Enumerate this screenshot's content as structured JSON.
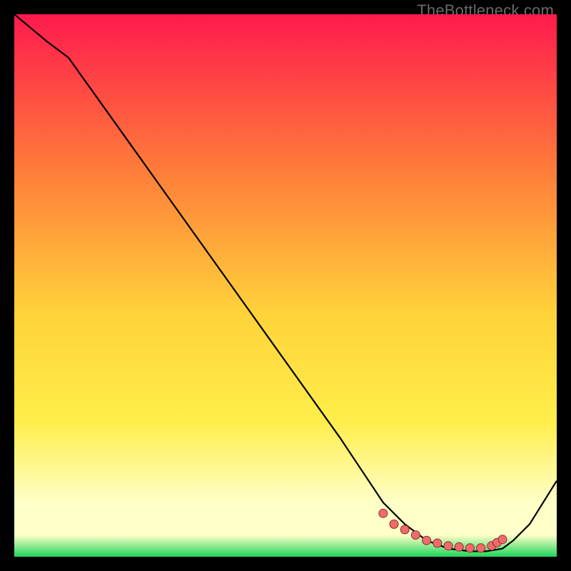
{
  "watermark": "TheBottleneck.com",
  "colors": {
    "bg_black": "#000000",
    "grad_top": "#ff1a4d",
    "grad_mid_upper": "#ff7a3a",
    "grad_mid": "#ffd23a",
    "grad_mid_lower": "#ffee4a",
    "grad_lower_pale": "#ffffc8",
    "grad_green": "#1fd65b",
    "curve_stroke": "#000000",
    "marker_fill": "#f06a6a",
    "marker_stroke": "#8b2e2e"
  },
  "chart_data": {
    "type": "line",
    "title": "",
    "xlabel": "",
    "ylabel": "",
    "xlim": [
      0,
      100
    ],
    "ylim": [
      0,
      100
    ],
    "series": [
      {
        "name": "bottleneck-curve",
        "x": [
          0,
          6,
          10,
          20,
          30,
          40,
          50,
          60,
          68,
          72,
          76,
          80,
          84,
          87,
          90,
          92,
          95,
          100
        ],
        "y": [
          100,
          95,
          92,
          78,
          64,
          50,
          36,
          22,
          10,
          6,
          3,
          1.5,
          1,
          1,
          1.5,
          3,
          6,
          14
        ]
      }
    ],
    "markers": {
      "name": "highlight-dots",
      "x": [
        68,
        70,
        72,
        74,
        76,
        78,
        80,
        82,
        84,
        86,
        88,
        89,
        90
      ],
      "y": [
        8,
        6,
        5,
        4,
        3,
        2.5,
        2,
        1.8,
        1.6,
        1.6,
        2,
        2.6,
        3.2
      ]
    }
  }
}
